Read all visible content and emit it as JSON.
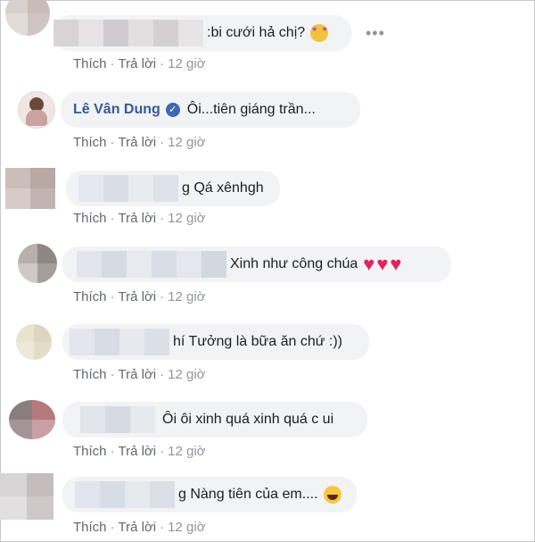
{
  "actions": {
    "like": "Thích",
    "reply": "Trả lời",
    "sep": "·"
  },
  "comments": [
    {
      "text": ":bi cưới hả chị?",
      "time": "12 giờ",
      "emoji": "star-struck-emoji"
    },
    {
      "author": "Lê Vân Dung",
      "verified": true,
      "text": "Ôi...tiên giáng trần...",
      "time": "12 giờ"
    },
    {
      "text": "g Qá xênhgh",
      "time": "12 giờ"
    },
    {
      "text": "Xinh như công chúa",
      "time": "12 giờ",
      "hearts": 3
    },
    {
      "text": "hí Tưởng là bữa ăn chứ :))",
      "time": "12 giờ"
    },
    {
      "text": "Ôi ôi xinh quá xinh quá c ui",
      "time": "12 giờ"
    },
    {
      "text": "g Nàng tiên của em....",
      "time": "12 giờ",
      "emoji": "laughing-tears-emoji"
    }
  ],
  "icons": {
    "more": "more-horizontal-icon",
    "verified": "verified-badge-icon",
    "heart": "heart-icon"
  },
  "colors": {
    "bubble": "#f2f3f5",
    "author": "#365899",
    "verified": "#4267b2",
    "heart": "#e0245e"
  }
}
